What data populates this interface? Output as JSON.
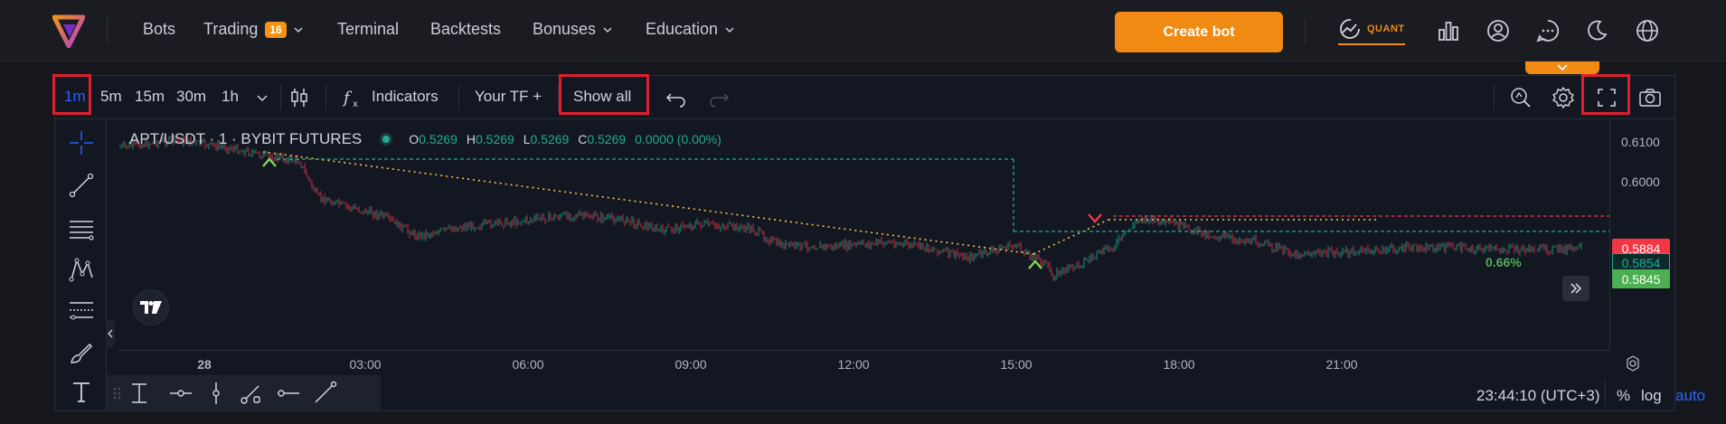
{
  "nav": {
    "items": [
      {
        "label": "Bots"
      },
      {
        "label": "Trading",
        "badge": "16"
      },
      {
        "label": "Terminal"
      },
      {
        "label": "Backtests"
      },
      {
        "label": "Bonuses"
      },
      {
        "label": "Education"
      }
    ],
    "create_bot": "Create bot",
    "quant_label": "QUANT"
  },
  "toolbar": {
    "timeframes": [
      "1m",
      "5m",
      "15m",
      "30m",
      "1h"
    ],
    "active_timeframe": "1m",
    "indicators": "Indicators",
    "your_tf": "Your TF +",
    "show_all": "Show all"
  },
  "legend": {
    "symbol": "APT/USDT · 1 · BYBIT FUTURES",
    "o_label": "O",
    "o": "0.5269",
    "h_label": "H",
    "h": "0.5269",
    "l_label": "L",
    "l": "0.5269",
    "c_label": "C",
    "c": "0.5269",
    "change": "0.0000 (0.00%)"
  },
  "price_axis": {
    "ticks": [
      "0.6100",
      "0.6000"
    ],
    "labels": {
      "red": "0.5884",
      "dark": "0.5854",
      "green": "0.5845"
    }
  },
  "trade_pct": "0.66%",
  "time_axis": [
    "28",
    "03:00",
    "06:00",
    "09:00",
    "12:00",
    "15:00",
    "18:00",
    "21:00"
  ],
  "bottom": {
    "clock": "23:44:10 (UTC+3)",
    "percent": "%",
    "log": "log",
    "auto": "auto"
  },
  "colors": {
    "accent": "#f08a12",
    "highlight_box": "#e01e2d",
    "up": "#22ab94",
    "down": "#f23645",
    "active_blue": "#2962ff"
  }
}
